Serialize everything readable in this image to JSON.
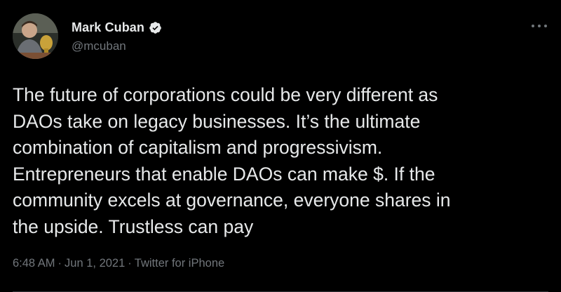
{
  "user": {
    "display_name": "Mark Cuban",
    "handle": "@mcuban",
    "verified": true
  },
  "tweet": {
    "text": "The future of corporations could be very different as\nDAOs take on legacy businesses. It’s the ultimate\ncombination of capitalism and progressivism.\nEntrepreneurs that enable DAOs can make $. If the\ncommunity excels at governance, everyone shares in\nthe upside. Trustless can pay"
  },
  "meta": {
    "time": "6:48 AM",
    "separator1": "·",
    "date": "Jun 1, 2021",
    "separator2": "·",
    "source": "Twitter for iPhone"
  },
  "icons": {
    "verified": "verified-badge-icon",
    "more": "more-options-icon"
  },
  "colors": {
    "background": "#000000",
    "primary_text": "#e7e9ea",
    "secondary_text": "#71767b"
  }
}
